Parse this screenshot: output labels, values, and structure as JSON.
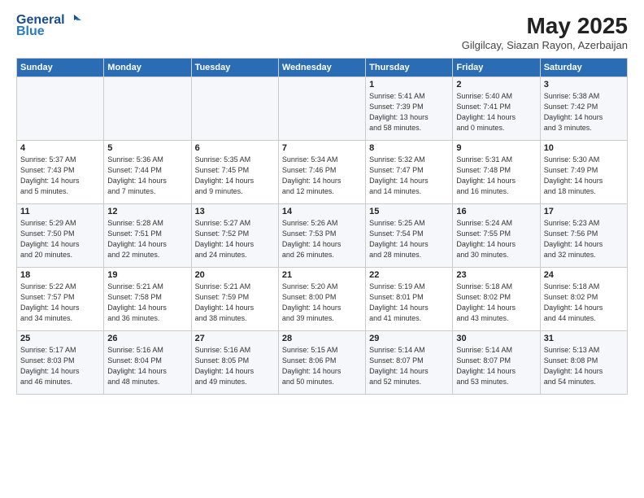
{
  "header": {
    "logo_line1": "General",
    "logo_line2": "Blue",
    "month": "May 2025",
    "location": "Gilgilcay, Siazan Rayon, Azerbaijan"
  },
  "weekdays": [
    "Sunday",
    "Monday",
    "Tuesday",
    "Wednesday",
    "Thursday",
    "Friday",
    "Saturday"
  ],
  "weeks": [
    [
      {
        "num": "",
        "info": ""
      },
      {
        "num": "",
        "info": ""
      },
      {
        "num": "",
        "info": ""
      },
      {
        "num": "",
        "info": ""
      },
      {
        "num": "1",
        "info": "Sunrise: 5:41 AM\nSunset: 7:39 PM\nDaylight: 13 hours\nand 58 minutes."
      },
      {
        "num": "2",
        "info": "Sunrise: 5:40 AM\nSunset: 7:41 PM\nDaylight: 14 hours\nand 0 minutes."
      },
      {
        "num": "3",
        "info": "Sunrise: 5:38 AM\nSunset: 7:42 PM\nDaylight: 14 hours\nand 3 minutes."
      }
    ],
    [
      {
        "num": "4",
        "info": "Sunrise: 5:37 AM\nSunset: 7:43 PM\nDaylight: 14 hours\nand 5 minutes."
      },
      {
        "num": "5",
        "info": "Sunrise: 5:36 AM\nSunset: 7:44 PM\nDaylight: 14 hours\nand 7 minutes."
      },
      {
        "num": "6",
        "info": "Sunrise: 5:35 AM\nSunset: 7:45 PM\nDaylight: 14 hours\nand 9 minutes."
      },
      {
        "num": "7",
        "info": "Sunrise: 5:34 AM\nSunset: 7:46 PM\nDaylight: 14 hours\nand 12 minutes."
      },
      {
        "num": "8",
        "info": "Sunrise: 5:32 AM\nSunset: 7:47 PM\nDaylight: 14 hours\nand 14 minutes."
      },
      {
        "num": "9",
        "info": "Sunrise: 5:31 AM\nSunset: 7:48 PM\nDaylight: 14 hours\nand 16 minutes."
      },
      {
        "num": "10",
        "info": "Sunrise: 5:30 AM\nSunset: 7:49 PM\nDaylight: 14 hours\nand 18 minutes."
      }
    ],
    [
      {
        "num": "11",
        "info": "Sunrise: 5:29 AM\nSunset: 7:50 PM\nDaylight: 14 hours\nand 20 minutes."
      },
      {
        "num": "12",
        "info": "Sunrise: 5:28 AM\nSunset: 7:51 PM\nDaylight: 14 hours\nand 22 minutes."
      },
      {
        "num": "13",
        "info": "Sunrise: 5:27 AM\nSunset: 7:52 PM\nDaylight: 14 hours\nand 24 minutes."
      },
      {
        "num": "14",
        "info": "Sunrise: 5:26 AM\nSunset: 7:53 PM\nDaylight: 14 hours\nand 26 minutes."
      },
      {
        "num": "15",
        "info": "Sunrise: 5:25 AM\nSunset: 7:54 PM\nDaylight: 14 hours\nand 28 minutes."
      },
      {
        "num": "16",
        "info": "Sunrise: 5:24 AM\nSunset: 7:55 PM\nDaylight: 14 hours\nand 30 minutes."
      },
      {
        "num": "17",
        "info": "Sunrise: 5:23 AM\nSunset: 7:56 PM\nDaylight: 14 hours\nand 32 minutes."
      }
    ],
    [
      {
        "num": "18",
        "info": "Sunrise: 5:22 AM\nSunset: 7:57 PM\nDaylight: 14 hours\nand 34 minutes."
      },
      {
        "num": "19",
        "info": "Sunrise: 5:21 AM\nSunset: 7:58 PM\nDaylight: 14 hours\nand 36 minutes."
      },
      {
        "num": "20",
        "info": "Sunrise: 5:21 AM\nSunset: 7:59 PM\nDaylight: 14 hours\nand 38 minutes."
      },
      {
        "num": "21",
        "info": "Sunrise: 5:20 AM\nSunset: 8:00 PM\nDaylight: 14 hours\nand 39 minutes."
      },
      {
        "num": "22",
        "info": "Sunrise: 5:19 AM\nSunset: 8:01 PM\nDaylight: 14 hours\nand 41 minutes."
      },
      {
        "num": "23",
        "info": "Sunrise: 5:18 AM\nSunset: 8:02 PM\nDaylight: 14 hours\nand 43 minutes."
      },
      {
        "num": "24",
        "info": "Sunrise: 5:18 AM\nSunset: 8:02 PM\nDaylight: 14 hours\nand 44 minutes."
      }
    ],
    [
      {
        "num": "25",
        "info": "Sunrise: 5:17 AM\nSunset: 8:03 PM\nDaylight: 14 hours\nand 46 minutes."
      },
      {
        "num": "26",
        "info": "Sunrise: 5:16 AM\nSunset: 8:04 PM\nDaylight: 14 hours\nand 48 minutes."
      },
      {
        "num": "27",
        "info": "Sunrise: 5:16 AM\nSunset: 8:05 PM\nDaylight: 14 hours\nand 49 minutes."
      },
      {
        "num": "28",
        "info": "Sunrise: 5:15 AM\nSunset: 8:06 PM\nDaylight: 14 hours\nand 50 minutes."
      },
      {
        "num": "29",
        "info": "Sunrise: 5:14 AM\nSunset: 8:07 PM\nDaylight: 14 hours\nand 52 minutes."
      },
      {
        "num": "30",
        "info": "Sunrise: 5:14 AM\nSunset: 8:07 PM\nDaylight: 14 hours\nand 53 minutes."
      },
      {
        "num": "31",
        "info": "Sunrise: 5:13 AM\nSunset: 8:08 PM\nDaylight: 14 hours\nand 54 minutes."
      }
    ]
  ]
}
